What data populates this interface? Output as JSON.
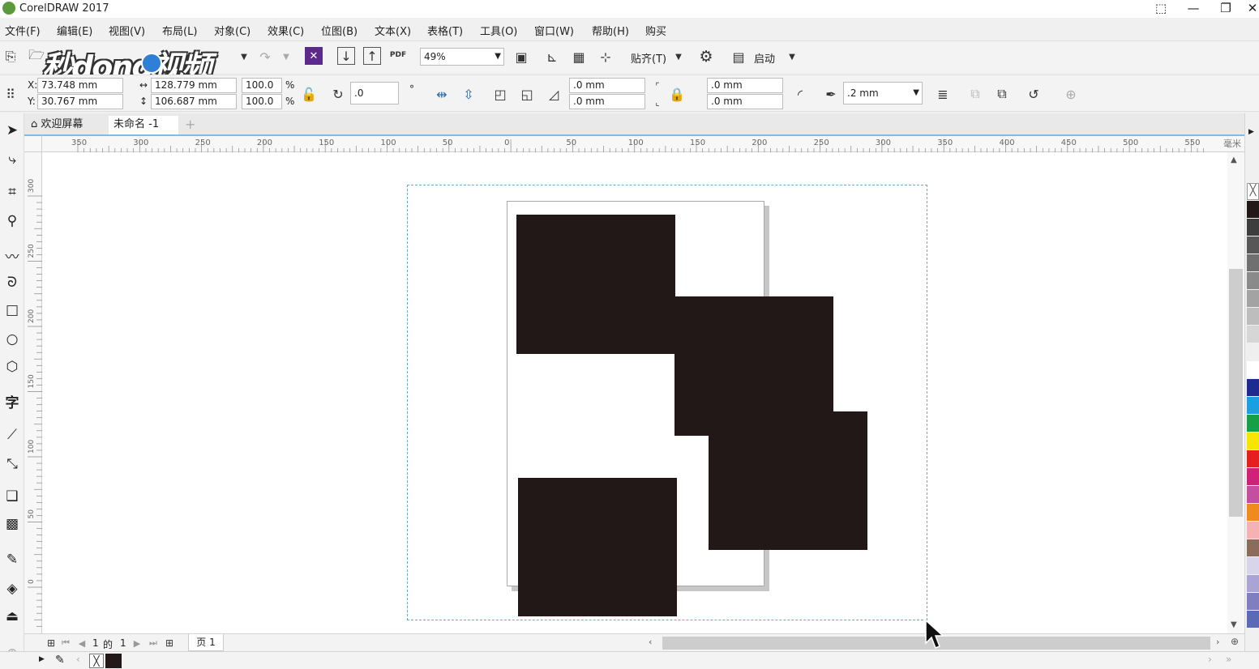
{
  "window": {
    "title": "CorelDRAW 2017",
    "min": "—",
    "max": "❐",
    "close": "✕"
  },
  "menu": [
    "文件(F)",
    "编辑(E)",
    "视图(V)",
    "布局(L)",
    "对象(C)",
    "效果(C)",
    "位图(B)",
    "文本(X)",
    "表格(T)",
    "工具(O)",
    "窗口(W)",
    "帮助(H)",
    "购买"
  ],
  "toolbar": {
    "zoom_value": "49%",
    "snap_label": "贴齐(T)",
    "launch_label": "启动",
    "pdf_label": "PDF"
  },
  "watermark": {
    "text": "秒dong视频"
  },
  "properties": {
    "x_label": "X:",
    "x_value": "73.748 mm",
    "y_label": "Y:",
    "y_value": "30.767 mm",
    "width_value": "128.779 mm",
    "height_value": "106.687 mm",
    "scale_x": "100.0",
    "scale_y": "100.0",
    "percent": "%",
    "rotation": ".0",
    "degree_symbol": "°",
    "corner_1": ".0 mm",
    "corner_2": ".0 mm",
    "corner_3": ".0 mm",
    "corner_4": ".0 mm",
    "outline_width": ".2 mm"
  },
  "tabs": {
    "welcome": "欢迎屏幕",
    "document": "未命名 -1",
    "add": "+"
  },
  "ruler": {
    "h_ticks": [
      "350",
      "300",
      "250",
      "200",
      "150",
      "100",
      "50",
      "0",
      "50",
      "100",
      "150",
      "200",
      "250",
      "300",
      "350",
      "400",
      "450",
      "500",
      "550"
    ],
    "v_ticks": [
      "300",
      "250",
      "200",
      "150",
      "100",
      "50",
      "0"
    ],
    "unit": "毫米"
  },
  "pagebar": {
    "current": "1",
    "of": "的",
    "total": "1",
    "page_tab": "页 1"
  },
  "palette": {
    "colors": [
      "#231818",
      "#3d3d3d",
      "#575757",
      "#707070",
      "#8a8a8a",
      "#a3a3a3",
      "#bdbdbd",
      "#d6d6d6",
      "#efefef",
      "#ffffff",
      "#1d2b8f",
      "#1aa0e0",
      "#15a045",
      "#f5e600",
      "#e51f1f",
      "#d02078",
      "#c44ea0",
      "#ef8a1c",
      "#f4b2b2",
      "#8b6b5a",
      "#d8d4ea",
      "#a9a4d4",
      "#7f7fc0",
      "#5a6bb5"
    ]
  },
  "colors": {
    "shape_fill": "#231818",
    "selection": "#6fa8c8",
    "accent": "#7dbde6"
  }
}
